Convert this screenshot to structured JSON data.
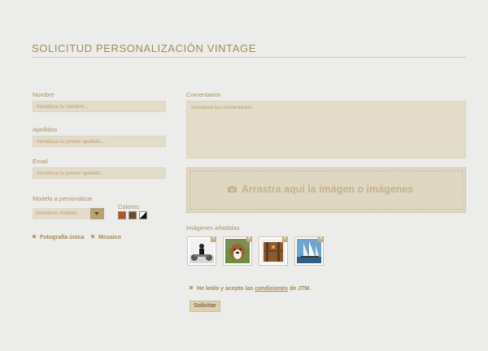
{
  "page": {
    "title": "SOLICITUD PERSONALIZACIÓN VINTAGE"
  },
  "form": {
    "nombre": {
      "label": "Nombre",
      "placeholder": "Introduce tu nombre..."
    },
    "apellidos": {
      "label": "Apellidos",
      "placeholder": "Introduce tu primer apellido..."
    },
    "email": {
      "label": "Email",
      "placeholder": "Introduce tu primer apellido..."
    },
    "modelo": {
      "label": "Modelo a personalizar",
      "selected": "Introduce modelo"
    },
    "colores": {
      "label": "Colores",
      "swatches": [
        "#b0542f",
        "#6e4a38",
        "black-white-diagonal"
      ]
    },
    "options": [
      {
        "label": "Fotografía única"
      },
      {
        "label": "Mosaico"
      }
    ],
    "comentarios": {
      "label": "Comentarios",
      "placeholder": "Introduce tus comentarios"
    },
    "dropzone": {
      "text": "Arrastra aqui la imágen o imágenes",
      "icon": "camera-icon"
    },
    "added": {
      "label": "Imágenes añadidas",
      "thumbnails": [
        {
          "subject": "man with motorcycle",
          "remove_icon": "close-icon"
        },
        {
          "subject": "bulldog on grass",
          "remove_icon": "close-icon"
        },
        {
          "subject": "leather bag",
          "remove_icon": "close-icon"
        },
        {
          "subject": "sailing ship",
          "remove_icon": "close-icon"
        }
      ]
    },
    "terms": {
      "prefix": "He leido y acepto las",
      "link": "condiciones",
      "suffix": "de JTM."
    },
    "submit": "Solicitar"
  },
  "colors": {
    "accent": "#a88f5c",
    "field_bg": "#e3dccb",
    "page_bg": "#ececea"
  }
}
